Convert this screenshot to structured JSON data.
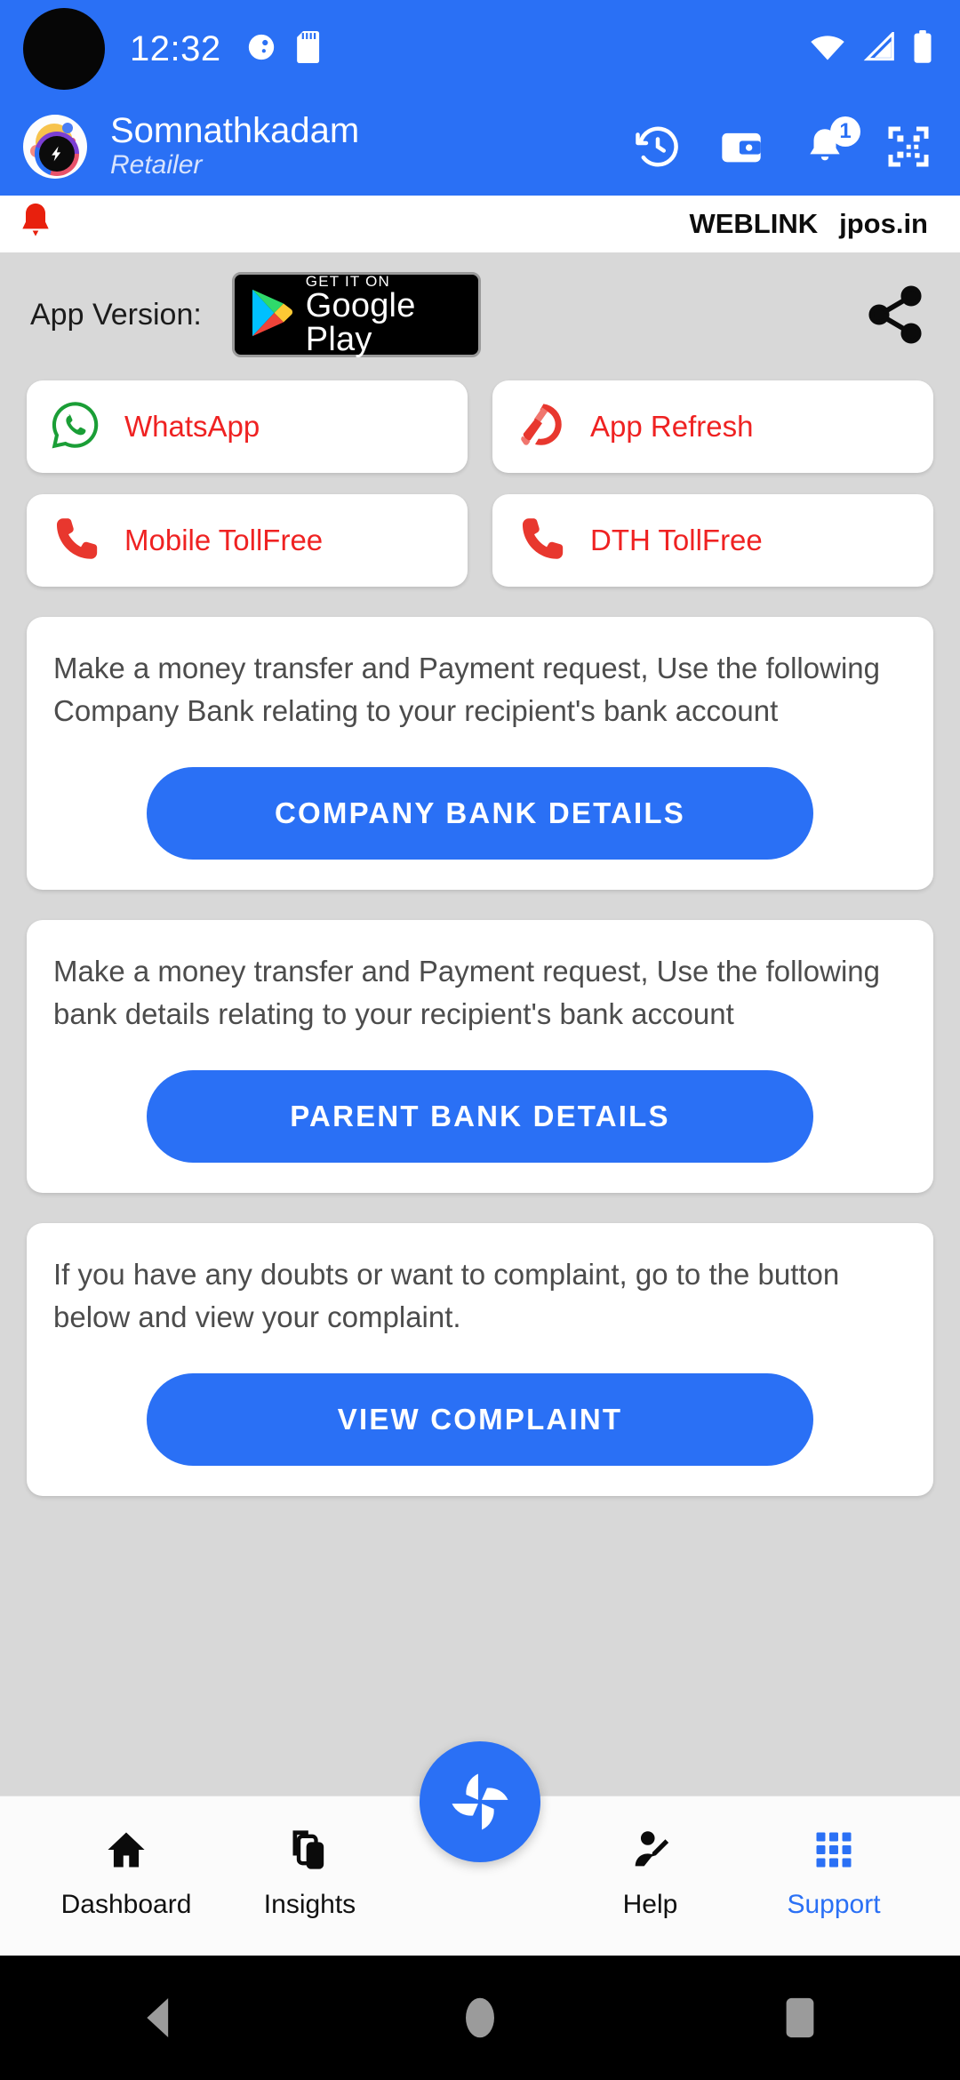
{
  "status_bar": {
    "time": "12:32",
    "icons": [
      "do-not-disturb-icon",
      "sd-card-icon"
    ],
    "right_icons": [
      "wifi-icon",
      "cellular-signal-icon",
      "battery-icon"
    ],
    "background_color": "#2a70f5"
  },
  "app_bar": {
    "avatar": "app-logo-avatar",
    "account_name": "Somnathkadam",
    "account_role": "Retailer",
    "actions": [
      {
        "name": "history-icon",
        "label": "History"
      },
      {
        "name": "wallet-icon",
        "label": "Wallet"
      },
      {
        "name": "notification-bell-icon",
        "label": "Notifications",
        "badge": "1"
      },
      {
        "name": "qr-scanner-icon",
        "label": "Scan QR"
      }
    ]
  },
  "weblink_bar": {
    "alert_icon": "bell-icon",
    "label": "WEBLINK",
    "url": "jpos.in"
  },
  "version_row": {
    "label": "App Version:",
    "play_badge": {
      "small_text": "GET IT ON",
      "big_text": "Google Play"
    },
    "share_icon": "share-icon"
  },
  "quick_actions": [
    {
      "icon": "whatsapp-icon",
      "label": "WhatsApp",
      "color": "#ef2222"
    },
    {
      "icon": "app-refresh-icon",
      "label": "App Refresh",
      "color": "#ef2222"
    },
    {
      "icon": "phone-icon",
      "label": "Mobile TollFree",
      "color": "#ef2222"
    },
    {
      "icon": "phone-icon",
      "label": "DTH TollFree",
      "color": "#ef2222"
    }
  ],
  "cards": [
    {
      "text": "Make a money transfer and Payment request, Use the following Company Bank relating to your recipient's bank account",
      "button": "COMPANY BANK DETAILS"
    },
    {
      "text": "Make a money transfer and Payment request, Use the following bank details relating to your recipient's bank account",
      "button": "PARENT BANK DETAILS"
    },
    {
      "text": "If you have any doubts or want to complaint, go to the button below and view your complaint.",
      "button": "VIEW COMPLAINT"
    }
  ],
  "bottom_nav": {
    "items": [
      {
        "icon": "home-icon",
        "label": "Dashboard",
        "active": false
      },
      {
        "icon": "layers-icon",
        "label": "Insights",
        "active": false
      },
      {
        "icon": "person-edit-icon",
        "label": "Help",
        "active": false
      },
      {
        "icon": "grid-apps-icon",
        "label": "Support",
        "active": true
      }
    ],
    "fab": {
      "icon": "pinwheel-icon"
    },
    "active_color": "#2a70f5"
  },
  "android_nav": {
    "buttons": [
      "back-button",
      "home-button",
      "recents-button"
    ]
  }
}
